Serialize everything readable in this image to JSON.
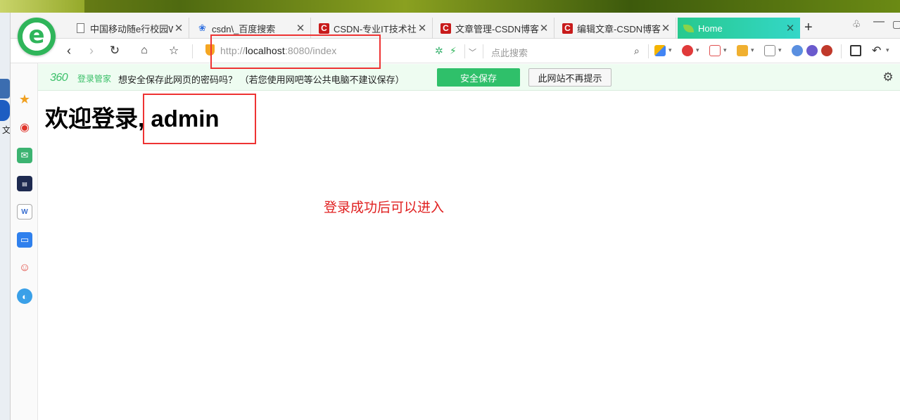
{
  "browser": {
    "tabs": [
      {
        "label": "中国移动随e行校园W",
        "icon": "page-icon",
        "active": false
      },
      {
        "label": "csdn\\_百度搜索",
        "icon": "baidu-paw-icon",
        "active": false
      },
      {
        "label": "CSDN-专业IT技术社区",
        "icon": "csdn-icon",
        "active": false
      },
      {
        "label": "文章管理-CSDN博客",
        "icon": "csdn-icon",
        "active": false
      },
      {
        "label": "编辑文章-CSDN博客",
        "icon": "csdn-icon",
        "active": false
      },
      {
        "label": "Home",
        "icon": "leaf-icon",
        "active": true
      }
    ],
    "address": {
      "scheme": "http://",
      "host": "localhost",
      "rest": ":8080/index"
    },
    "search_placeholder": "点此搜索"
  },
  "infobar": {
    "brand": "360",
    "brand_sub": "登录管家",
    "message": "想安全保存此网页的密码吗？ （若您使用网吧等公共电脑不建议保存）",
    "save_label": "安全保存",
    "never_label": "此网站不再提示"
  },
  "desktop": {
    "side_text": "文"
  },
  "page": {
    "heading": "欢迎登录, admin",
    "notice": "登录成功后可以进入"
  },
  "colors": {
    "active_tab_start": "#27c98e",
    "active_tab_end": "#34d7c8",
    "save_button": "#2fc06a",
    "notice_text": "#e02020",
    "annotation": "#e33333"
  }
}
